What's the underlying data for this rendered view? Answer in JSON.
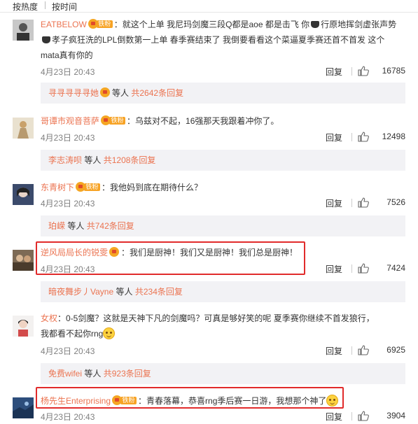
{
  "sort": {
    "hot": "按热度",
    "time": "按时间"
  },
  "comments": [
    {
      "user": "EATBELOW",
      "badge": "铁粉",
      "text1": "：就这个上单 我尼玛剑魔三段Q都是aoe 都是击飞  你",
      "text2": "行原地挥剑虚张声势",
      "text3": "孝子疯狂洗的LPL倒数第一上单 春季赛结束了 我倒要看看这个菜逼夏季赛还首不首发    这个",
      "text4": "mata真有你的",
      "time": "4月23日 20:43",
      "reply_label": "回复",
      "likes": "16785",
      "sub_who": "寻寻寻寻寻她",
      "sub_mid": "等人",
      "sub_count": "共2642条回复"
    },
    {
      "user": "哥谭市观音菩萨",
      "badge": "铁粉",
      "text1": "：乌兹对不起，16强那天我跟着冲你了。",
      "time": "4月23日 20:43",
      "reply_label": "回复",
      "likes": "12498",
      "sub_who": "李志涛呗",
      "sub_mid": "等人",
      "sub_count": "共1208条回复"
    },
    {
      "user": "东青树下",
      "badge": "铁粉",
      "text1": "：我他妈到底在期待什么？",
      "time": "4月23日 20:43",
      "reply_label": "回复",
      "likes": "7526",
      "sub_who": "珀嵘",
      "sub_mid": "等人",
      "sub_count": "共742条回复"
    },
    {
      "user": "逆风局局长的锐雯",
      "badge": "",
      "text1": "：我们是厨神！我们又是厨神！我们总是厨神！",
      "time": "4月23日 20:43",
      "reply_label": "回复",
      "likes": "7424",
      "sub_who": "暗夜舞步丿Vayne",
      "sub_mid": "等人",
      "sub_count": "共234条回复"
    },
    {
      "user": "女权",
      "badge": "",
      "text1": "：0-5剑魔？这就是天神下凡的剑魔吗？可真是够好笑的呢 夏季赛你继续不首发狼行，",
      "text2": "我都看不起你rng",
      "time": "4月23日 20:43",
      "reply_label": "回复",
      "likes": "6925",
      "sub_who": "免费wifei",
      "sub_mid": "等人",
      "sub_count": "共923条回复"
    },
    {
      "user": "杨先生Enterprising",
      "badge": "铁粉",
      "text1": "：青春落幕，恭喜rng季后赛一日游，我想那个神了",
      "time": "4月23日 20:43",
      "reply_label": "回复",
      "likes": "3904"
    }
  ]
}
